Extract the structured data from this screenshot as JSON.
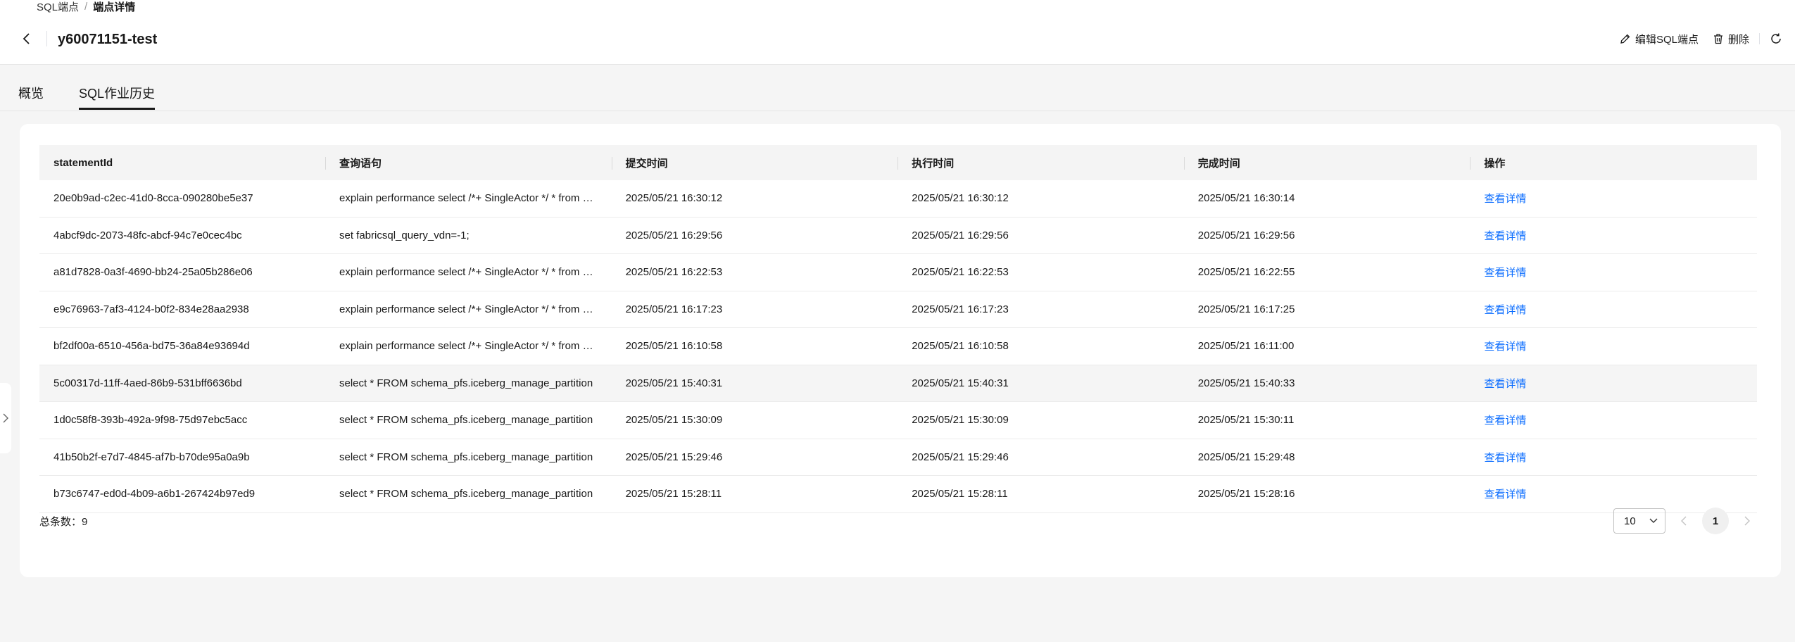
{
  "breadcrumb": {
    "parent": "SQL端点",
    "separator": "/",
    "current": "端点详情"
  },
  "header": {
    "title": "y60071151-test"
  },
  "actions": {
    "edit_label": "编辑SQL端点",
    "delete_label": "删除"
  },
  "tabs": [
    {
      "label": "概览",
      "active": false
    },
    {
      "label": "SQL作业历史",
      "active": true
    }
  ],
  "table": {
    "columns": [
      "statementId",
      "查询语句",
      "提交时间",
      "执行时间",
      "完成时间",
      "操作"
    ],
    "rows": [
      {
        "id": "20e0b9ad-c2ec-41d0-8cca-090280be5e37",
        "query": "explain performance select /*+ SingleActor */ * from schema_pfs.iceberg_manage_partition",
        "submit": "2025/05/21 16:30:12",
        "exec": "2025/05/21 16:30:12",
        "finish": "2025/05/21 16:30:14",
        "action": "查看详情"
      },
      {
        "id": "4abcf9dc-2073-48fc-abcf-94c7e0cec4bc",
        "query": "set fabricsql_query_vdn=-1;",
        "submit": "2025/05/21 16:29:56",
        "exec": "2025/05/21 16:29:56",
        "finish": "2025/05/21 16:29:56",
        "action": "查看详情"
      },
      {
        "id": "a81d7828-0a3f-4690-bb24-25a05b286e06",
        "query": "explain performance select /*+ SingleActor */ * from schema_pfs.iceberg_manage_partition",
        "submit": "2025/05/21 16:22:53",
        "exec": "2025/05/21 16:22:53",
        "finish": "2025/05/21 16:22:55",
        "action": "查看详情"
      },
      {
        "id": "e9c76963-7af3-4124-b0f2-834e28aa2938",
        "query": "explain performance select /*+ SingleActor */ * from schema_pfs.iceberg_manage_partition",
        "submit": "2025/05/21 16:17:23",
        "exec": "2025/05/21 16:17:23",
        "finish": "2025/05/21 16:17:25",
        "action": "查看详情"
      },
      {
        "id": "bf2df00a-6510-456a-bd75-36a84e93694d",
        "query": "explain performance select /*+ SingleActor */ * from schema_pfs.iceberg_manage_partition",
        "submit": "2025/05/21 16:10:58",
        "exec": "2025/05/21 16:10:58",
        "finish": "2025/05/21 16:11:00",
        "action": "查看详情"
      },
      {
        "id": "5c00317d-11ff-4aed-86b9-531bff6636bd",
        "query": "select * FROM schema_pfs.iceberg_manage_partition",
        "submit": "2025/05/21 15:40:31",
        "exec": "2025/05/21 15:40:31",
        "finish": "2025/05/21 15:40:33",
        "action": "查看详情",
        "hover": true
      },
      {
        "id": "1d0c58f8-393b-492a-9f98-75d97ebc5acc",
        "query": "select * FROM schema_pfs.iceberg_manage_partition",
        "submit": "2025/05/21 15:30:09",
        "exec": "2025/05/21 15:30:09",
        "finish": "2025/05/21 15:30:11",
        "action": "查看详情"
      },
      {
        "id": "41b50b2f-e7d7-4845-af7b-b70de95a0a9b",
        "query": "select * FROM schema_pfs.iceberg_manage_partition",
        "submit": "2025/05/21 15:29:46",
        "exec": "2025/05/21 15:29:46",
        "finish": "2025/05/21 15:29:48",
        "action": "查看详情"
      },
      {
        "id": "b73c6747-ed0d-4b09-a6b1-267424b97ed9",
        "query": "select * FROM schema_pfs.iceberg_manage_partition",
        "submit": "2025/05/21 15:28:11",
        "exec": "2025/05/21 15:28:11",
        "finish": "2025/05/21 15:28:16",
        "action": "查看详情"
      }
    ]
  },
  "footer": {
    "total_text": "总条数：9"
  },
  "pagination": {
    "page_size": "10",
    "current_page": "1"
  },
  "colors": {
    "accent": "#0a6cff",
    "tab_active": "#191919",
    "header_bg": "#f4f4f4"
  },
  "icons": {
    "back": "chevron-left-icon",
    "edit": "pencil-icon",
    "delete": "trash-icon",
    "refresh": "refresh-icon",
    "side": "chevron-right-icon"
  }
}
